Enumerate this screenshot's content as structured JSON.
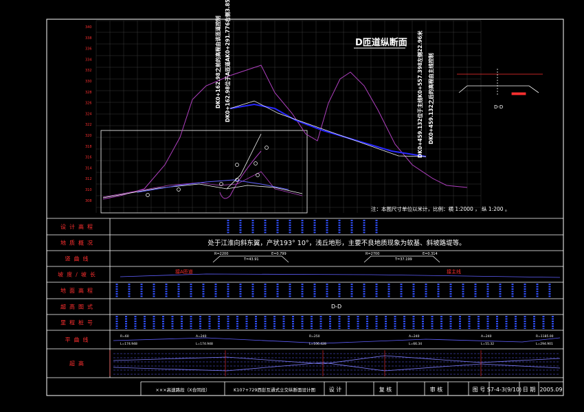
{
  "title": "D匝道纵断面",
  "annotations": {
    "left_1": "DK0+162.98之前的高程由该匝道控制",
    "left_2": "DK0+162.98位于A匝道AK0+291.776右侧3.85米",
    "right_1": "DK0+459.132位于主线K0+557.398左侧22.96米",
    "right_2": "DK0+459.132之后的高程由主线控制"
  },
  "note": "注：本图尺寸单位以米计，比例：横 1:2000 ， 纵 1:200 。",
  "section_label": "D-D",
  "y_axis_ticks": [
    "340",
    "338",
    "336",
    "334",
    "332",
    "330",
    "328",
    "326",
    "324",
    "322",
    "320",
    "318",
    "316",
    "314",
    "312",
    "310",
    "308"
  ],
  "row_labels": [
    "设计高程",
    "地质概况",
    "竖曲线",
    "坡度/坡长",
    "地面高程",
    "超高图式",
    "里程桩号",
    "平曲线",
    "超高"
  ],
  "geology_text": "处于江淮向斜东翼，产状193° 10°，浅丘地形，主要不良地质现象为软基、斜坡路堤等。",
  "vertical_curves": [
    {
      "r": "R=2200",
      "t": "T=43.91",
      "e": "E=0.799"
    },
    {
      "r": "R=2700",
      "t": "T=37.199",
      "e": "E=0.314"
    }
  ],
  "slope_labels": [
    "接A匝道",
    "接主线"
  ],
  "row_center_label": "D-D",
  "plan_curves": [
    {
      "top": "R=60",
      "bot": "L=174.948"
    },
    {
      "top": "A=240",
      "bot": "L=174.948"
    },
    {
      "top": "R=250",
      "bot": "L=106.428"
    },
    {
      "top": "A=240",
      "bot": "L=66.34"
    },
    {
      "top": "A=240",
      "bot": "L=55.32"
    },
    {
      "top": "R=1185.00",
      "bot": "L=294.901"
    }
  ],
  "title_block": {
    "project": "×××高速路段（X合同段）",
    "drawing_name": "K107+729西彭互通式立交纵断面设计图",
    "design": "设 计",
    "review": "复 核",
    "approve": "审 核",
    "fig_no_label": "图 号",
    "fig_no": "S7-4-3(9/10)",
    "date_label": "日 期",
    "date": "2005.09"
  },
  "section_detail": {
    "label": "D-D"
  },
  "colors": {
    "frame": "#ffffff",
    "grid": "#5a5a5a",
    "row_label": "#ff3030",
    "ground_line": "#b040c0",
    "design_line": "#3030ff",
    "table_value": "#3050ff"
  }
}
